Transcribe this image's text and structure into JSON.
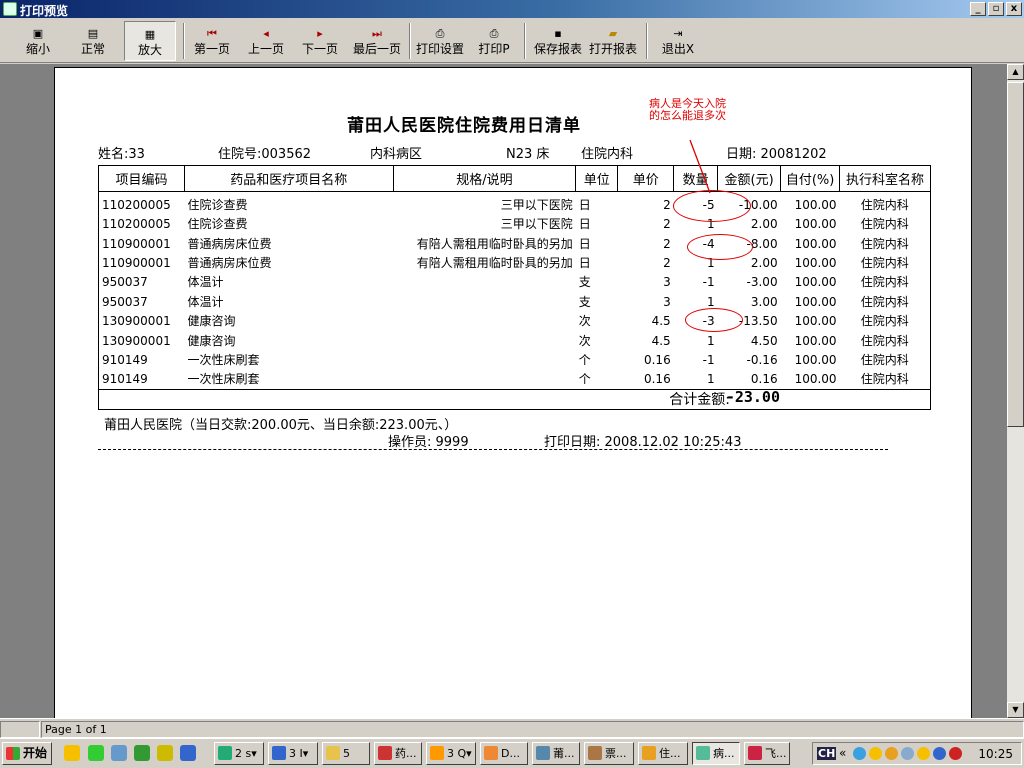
{
  "window": {
    "title": "打印预览",
    "min": "_",
    "max": "▫",
    "close": "x"
  },
  "toolbar": {
    "zoom_out": "缩小",
    "normal": "正常",
    "zoom_in": "放大",
    "first_page": "第一页",
    "prev_page": "上一页",
    "next_page": "下一页",
    "last_page": "最后一页",
    "print_setup": "打印设置",
    "print": "打印P",
    "save_report": "保存报表",
    "open_report": "打开报表",
    "exit": "退出X"
  },
  "report": {
    "title": "莆田人民医院住院费用日清单",
    "patient_name": "姓名:33",
    "admission_no": "住院号:003562",
    "ward": "内科病区",
    "bed": "N23 床",
    "department": "住院内科",
    "date": "日期: 20081202",
    "columns": [
      "项目编码",
      "药品和医疗项目名称",
      "规格/说明",
      "单位",
      "单价",
      "数量",
      "金额(元)",
      "自付(%)",
      "执行科室名称"
    ],
    "rows": [
      {
        "code": "110200005",
        "name": "住院诊查费",
        "spec": "三甲以下医院",
        "unit": "日",
        "price": "2",
        "qty": "-5",
        "amount": "-10.00",
        "self_pay": "100.00",
        "dept": "住院内科"
      },
      {
        "code": "110200005",
        "name": "住院诊查费",
        "spec": "三甲以下医院",
        "unit": "日",
        "price": "2",
        "qty": "1",
        "amount": "2.00",
        "self_pay": "100.00",
        "dept": "住院内科"
      },
      {
        "code": "110900001",
        "name": "普通病房床位费",
        "spec": "有陪人需租用临时卧具的另加",
        "unit": "日",
        "price": "2",
        "qty": "-4",
        "amount": "-8.00",
        "self_pay": "100.00",
        "dept": "住院内科"
      },
      {
        "code": "110900001",
        "name": "普通病房床位费",
        "spec": "有陪人需租用临时卧具的另加",
        "unit": "日",
        "price": "2",
        "qty": "1",
        "amount": "2.00",
        "self_pay": "100.00",
        "dept": "住院内科"
      },
      {
        "code": "950037",
        "name": "体温计",
        "spec": "",
        "unit": "支",
        "price": "3",
        "qty": "-1",
        "amount": "-3.00",
        "self_pay": "100.00",
        "dept": "住院内科"
      },
      {
        "code": "950037",
        "name": "体温计",
        "spec": "",
        "unit": "支",
        "price": "3",
        "qty": "1",
        "amount": "3.00",
        "self_pay": "100.00",
        "dept": "住院内科"
      },
      {
        "code": "130900001",
        "name": "健康咨询",
        "spec": "",
        "unit": "次",
        "price": "4.5",
        "qty": "-3",
        "amount": "-13.50",
        "self_pay": "100.00",
        "dept": "住院内科"
      },
      {
        "code": "130900001",
        "name": "健康咨询",
        "spec": "",
        "unit": "次",
        "price": "4.5",
        "qty": "1",
        "amount": "4.50",
        "self_pay": "100.00",
        "dept": "住院内科"
      },
      {
        "code": "910149",
        "name": "一次性床刷套",
        "spec": "",
        "unit": "个",
        "price": "0.16",
        "qty": "-1",
        "amount": "-0.16",
        "self_pay": "100.00",
        "dept": "住院内科"
      },
      {
        "code": "910149",
        "name": "一次性床刷套",
        "spec": "",
        "unit": "个",
        "price": "0.16",
        "qty": "1",
        "amount": "0.16",
        "self_pay": "100.00",
        "dept": "住院内科"
      }
    ],
    "total_label": "合计金额:",
    "total_value": "-23.00",
    "footer_hospital": "莆田人民医院（当日交款:200.00元、当日余额:223.00元、）",
    "operator": "操作员: 9999",
    "print_date": "打印日期: 2008.12.02 10:25:43"
  },
  "annotation": {
    "note": "病人是今天入院的怎么能退多次",
    "color": "#e00000"
  },
  "status": {
    "page": "Page 1 of 1"
  },
  "taskbar": {
    "start": "开始",
    "tasks": [
      {
        "label": "2 s▾",
        "color": "#2a7"
      },
      {
        "label": "3 I▾",
        "color": "#36c"
      },
      {
        "label": "5 W▾",
        "color": "#e7c34b"
      },
      {
        "label": "药...",
        "color": "#c33"
      },
      {
        "label": "3 Q▾",
        "color": "#f90"
      },
      {
        "label": "D...",
        "color": "#e83"
      },
      {
        "label": "莆...",
        "color": "#58a"
      },
      {
        "label": "票...",
        "color": "#a74"
      },
      {
        "label": "住...",
        "color": "#e8a020"
      },
      {
        "label": "病...",
        "color": "#5b9"
      },
      {
        "label": "飞...",
        "color": "#c24"
      }
    ],
    "tray_prefix": "CH",
    "clock": "10:25"
  }
}
